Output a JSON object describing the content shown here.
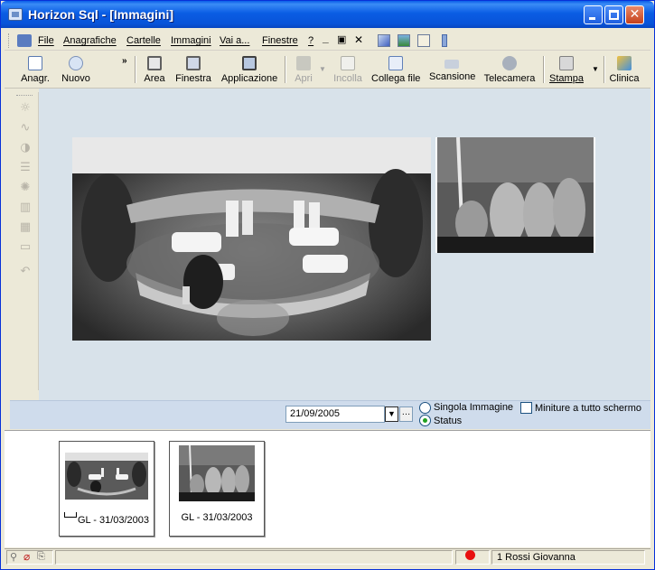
{
  "window": {
    "title": "Horizon Sql - [Immagini]"
  },
  "menu": {
    "items": [
      "File",
      "Anagrafiche",
      "Cartelle",
      "Immagini",
      "Vai a...",
      "Finestre",
      "?"
    ],
    "controls": [
      "‗",
      "🗗",
      "✕"
    ]
  },
  "toolbar": {
    "items": [
      {
        "label": "Anagr.",
        "icon": "patient-record-icon",
        "enabled": true
      },
      {
        "label": "Nuovo",
        "icon": "new-patient-icon",
        "enabled": true
      },
      {
        "label": "Area",
        "icon": "area-select-icon",
        "enabled": true
      },
      {
        "label": "Finestra",
        "icon": "window-select-icon",
        "enabled": true
      },
      {
        "label": "Applicazione",
        "icon": "application-select-icon",
        "enabled": true
      },
      {
        "label": "Apri",
        "icon": "open-folder-icon",
        "enabled": false
      },
      {
        "label": "Incolla",
        "icon": "paste-icon",
        "enabled": false
      },
      {
        "label": "Collega file",
        "icon": "link-file-icon",
        "enabled": true
      },
      {
        "label": "Scansione",
        "icon": "scanner-icon",
        "enabled": true
      },
      {
        "label": "Telecamera",
        "icon": "camera-icon",
        "enabled": true
      },
      {
        "label": "Stampa",
        "icon": "printer-icon",
        "enabled": true
      },
      {
        "label": "Clinica",
        "icon": "clinic-icon",
        "enabled": true
      }
    ],
    "overflow": "»"
  },
  "side_tools": [
    "brightness-icon",
    "curve-icon",
    "contrast-icon",
    "window-level-icon",
    "sharpen-icon",
    "filter-icon",
    "grid-icon",
    "ruler-icon",
    "undo-icon"
  ],
  "viewer": {
    "date": "21/09/2005",
    "modes": [
      {
        "label": "Singola Immagine",
        "selected": false
      },
      {
        "label": "Status",
        "selected": true
      }
    ],
    "fullscreen_thumbs_label": "Miniture a tutto schermo",
    "fullscreen_thumbs_checked": false
  },
  "thumbnails": [
    {
      "caption": "GL - 31/03/2003",
      "type": "panoramic",
      "has_ruler": true
    },
    {
      "caption": "GL - 31/03/2003",
      "type": "periapical",
      "has_ruler": false
    }
  ],
  "status": {
    "patient": "1 Rossi Giovanna",
    "indicator_color": "#e81010"
  }
}
